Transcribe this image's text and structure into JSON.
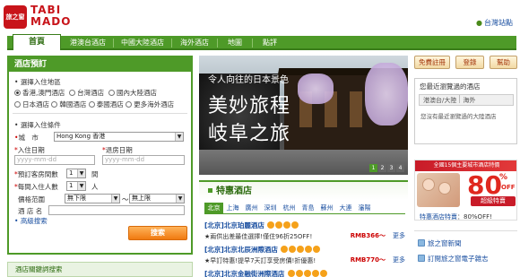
{
  "header": {
    "logo_badge": "旅之窗",
    "logo_line1": "TABI",
    "logo_line2": "MADO",
    "site_link": "台灣站點"
  },
  "nav": {
    "items": [
      "首頁",
      "港澳台酒店",
      "中國大陸酒店",
      "海外酒店",
      "地圖",
      "點評"
    ]
  },
  "booking": {
    "title": "酒店預訂",
    "region_label": "選擇入住地區",
    "regions_row1": [
      "香港,澳門酒店",
      "台灣酒店",
      "國內大陸酒店"
    ],
    "regions_row2": [
      "日本酒店",
      "韓國酒店",
      "泰國酒店",
      "更多海外酒店"
    ],
    "conditions_label": "選擇入住條件",
    "city_label": "城　市",
    "city_value": "Hong Kong 香港",
    "checkin_label": "入住日期",
    "checkout_label": "退房日期",
    "date_placeholder": "yyyy-mm-dd",
    "rooms_label": "預訂客房間數",
    "rooms_value": "1",
    "rooms_unit": "間",
    "guests_label": "每間入住人數",
    "guests_value": "1",
    "guests_unit": "人",
    "price_label": "價格范圍",
    "price_min": "無下限",
    "price_tilde": "～",
    "price_max": "無上限",
    "hotel_name_label": "酒 店 名",
    "advanced_link": "高級搜索",
    "search_button": "搜索"
  },
  "bottom_bar": "酒店關鍵詞搜索",
  "banner": {
    "subtitle": "令人向往的日本景色",
    "title1": "美妙旅程",
    "title2": "岐阜之旅",
    "pages": [
      "1",
      "2",
      "3",
      "4"
    ]
  },
  "special": {
    "title": "特惠酒店",
    "cities": [
      "北京",
      "上海",
      "廣州",
      "深圳",
      "杭州",
      "青島",
      "蘇州",
      "大連",
      "瀋陽"
    ],
    "hotels": [
      {
        "name": "[北京]北京珀麗酒店",
        "desc": "★兩供出差最佳選擇!僅住96折25OFF!",
        "price": "RMB366～",
        "more": "更多"
      },
      {
        "name": "[北京]北京北辰洲際酒店",
        "desc": "★早訂特惠!提早7天訂享受房價!折優惠!",
        "price": "RMB770～",
        "more": "更多"
      },
      {
        "name": "[北京]北京金融街洲際酒店",
        "desc": "",
        "price": "",
        "more": ""
      }
    ]
  },
  "right": {
    "btn_free": "免費註冊",
    "btn_login": "登錄",
    "btn_help": "幫助",
    "recent_title": "您最近瀏覽過的酒店",
    "recent_tab1": "港澳台/大陸",
    "recent_tab2": "海外",
    "recent_empty": "您沒有最近瀏覽過的大陸酒店",
    "promo_head": "全國15個主要城市酒店特價",
    "promo_big": "80",
    "promo_pct": "%",
    "promo_off": "OFF",
    "promo_badge": "超級特賣",
    "promo_caption_name": "特惠酒店特賣",
    "promo_caption_rest": "：80%OFF!",
    "links": [
      "旅之窗新聞",
      "訂閱旅之窗電子雜志"
    ]
  }
}
